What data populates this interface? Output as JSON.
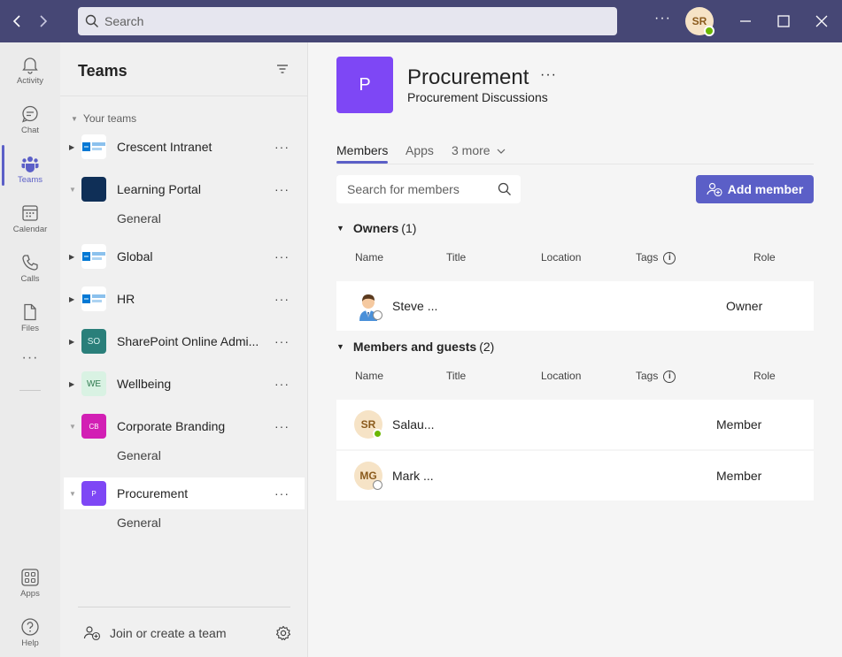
{
  "titlebar": {
    "search_placeholder": "Search",
    "avatar_initials": "SR",
    "more_label": "···"
  },
  "rail": {
    "items": [
      {
        "label": "Activity",
        "icon": "bell-icon"
      },
      {
        "label": "Chat",
        "icon": "chat-icon"
      },
      {
        "label": "Teams",
        "icon": "teams-icon"
      },
      {
        "label": "Calendar",
        "icon": "calendar-icon"
      },
      {
        "label": "Calls",
        "icon": "phone-icon"
      },
      {
        "label": "Files",
        "icon": "file-icon"
      },
      {
        "label": "Apps",
        "icon": "apps-icon"
      },
      {
        "label": "Help",
        "icon": "help-icon"
      }
    ],
    "more_label": "···"
  },
  "pane": {
    "title": "Teams",
    "section_label": "Your teams",
    "teams": [
      {
        "name": "Crescent Intranet",
        "logo_text": "SharePoint Online",
        "expanded": false
      },
      {
        "name": "Learning Portal",
        "logo_text": "",
        "expanded": true,
        "channels": [
          "General"
        ]
      },
      {
        "name": "Global",
        "logo_text": "SharePoint Online",
        "expanded": false
      },
      {
        "name": "HR",
        "logo_text": "SharePoint Online",
        "expanded": false
      },
      {
        "name": "SharePoint Online Admi...",
        "logo_text": "SO",
        "expanded": false
      },
      {
        "name": "Wellbeing",
        "logo_text": "WE",
        "expanded": false
      },
      {
        "name": "Corporate Branding",
        "logo_text": "CB",
        "expanded": true,
        "channels": [
          "General"
        ]
      },
      {
        "name": "Procurement",
        "logo_text": "P",
        "expanded": true,
        "channels": [
          "General"
        ]
      }
    ],
    "join_label": "Join or create a team"
  },
  "main": {
    "tile_letter": "P",
    "title": "Procurement",
    "subtitle": "Procurement Discussions",
    "tabs": [
      "Members",
      "Apps",
      "3 more"
    ],
    "search_placeholder": "Search for members",
    "add_member_label": "Add member",
    "owners": {
      "heading": "Owners",
      "count": "(1)",
      "members": [
        {
          "name": "Steve ...",
          "role": "Owner",
          "avatar": "photo",
          "status": "offline"
        }
      ]
    },
    "members_guests": {
      "heading": "Members and guests",
      "count": "(2)",
      "members": [
        {
          "name": "Salau...",
          "role": "Member",
          "initials": "SR",
          "status": "available"
        },
        {
          "name": "Mark ...",
          "role": "Member",
          "initials": "MG",
          "status": "offline"
        }
      ]
    },
    "columns": [
      "Name",
      "Title",
      "Location",
      "Tags",
      "Role"
    ]
  },
  "colors": {
    "titlebar": "#464775",
    "accent": "#5b5fc7",
    "team_tile": "#7e47f5"
  }
}
